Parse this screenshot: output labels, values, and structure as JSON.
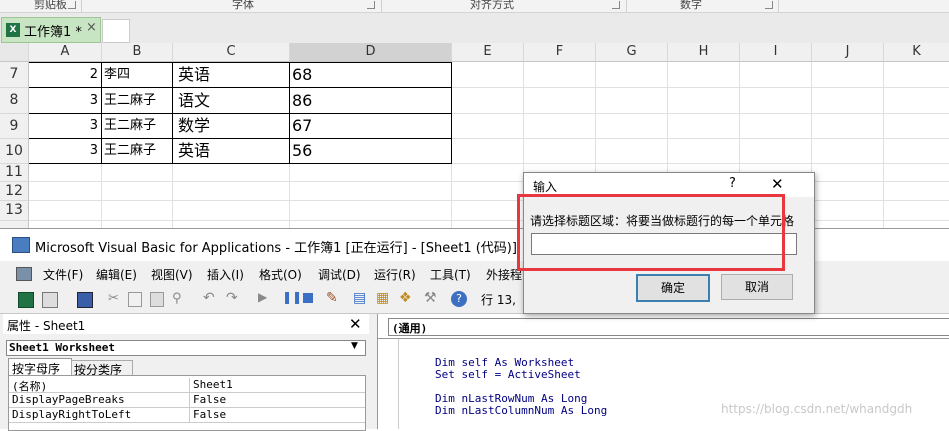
{
  "ribbon": {
    "groups": [
      "剪贴板",
      "字体",
      "对齐方式",
      "数字"
    ]
  },
  "workbook_tab": {
    "name": "工作簿1 *",
    "close": "×"
  },
  "sheet": {
    "columns": [
      "A",
      "B",
      "C",
      "D",
      "E",
      "F",
      "G",
      "H",
      "I",
      "J",
      "K"
    ],
    "rows": [
      {
        "num": "7",
        "a": "2",
        "b": "李四",
        "c": "英语",
        "d": "68"
      },
      {
        "num": "8",
        "a": "3",
        "b": "王二麻子",
        "c": "语文",
        "d": "86"
      },
      {
        "num": "9",
        "a": "3",
        "b": "王二麻子",
        "c": "数学",
        "d": "67"
      },
      {
        "num": "10",
        "a": "3",
        "b": "王二麻子",
        "c": "英语",
        "d": "56"
      },
      {
        "num": "11",
        "a": "",
        "b": "",
        "c": "",
        "d": ""
      },
      {
        "num": "12",
        "a": "",
        "b": "",
        "c": "",
        "d": ""
      },
      {
        "num": "13",
        "a": "",
        "b": "",
        "c": "",
        "d": ""
      }
    ]
  },
  "vbe": {
    "title": "Microsoft Visual Basic for Applications - 工作簿1 [正在运行] - [Sheet1 (代码)]",
    "menu": [
      "文件(F)",
      "编辑(E)",
      "视图(V)",
      "插入(I)",
      "格式(O)",
      "调试(D)",
      "运行(R)",
      "工具(T)",
      "外接程"
    ],
    "toolbar_status": "行 13,",
    "properties": {
      "title": "属性 - Sheet1",
      "close": "✕",
      "object": "Sheet1 Worksheet",
      "tabs": [
        "按字母序",
        "按分类序"
      ],
      "rows": [
        {
          "name": "(名称)",
          "value": "Sheet1"
        },
        {
          "name": "DisplayPageBreaks",
          "value": "False"
        },
        {
          "name": "DisplayRightToLeft",
          "value": "False"
        }
      ]
    },
    "code": {
      "object_dropdown": "(通用)",
      "lines": [
        "Dim self As Worksheet",
        "Set self = ActiveSheet",
        "",
        "Dim nLastRowNum As Long",
        "Dim nLastColumnNum As Long"
      ]
    }
  },
  "dialog": {
    "title": "输入",
    "help": "?",
    "close": "✕",
    "prompt": "请选择标题区域：将要当做标题行的每一个单元格",
    "input_value": "",
    "ok": "确定",
    "cancel": "取消"
  },
  "watermark": "https://blog.csdn.net/whandgdh",
  "colors": {
    "highlight_box": "#e8373f",
    "tab_green": "#c8e5c3",
    "excel_green": "#217346"
  }
}
